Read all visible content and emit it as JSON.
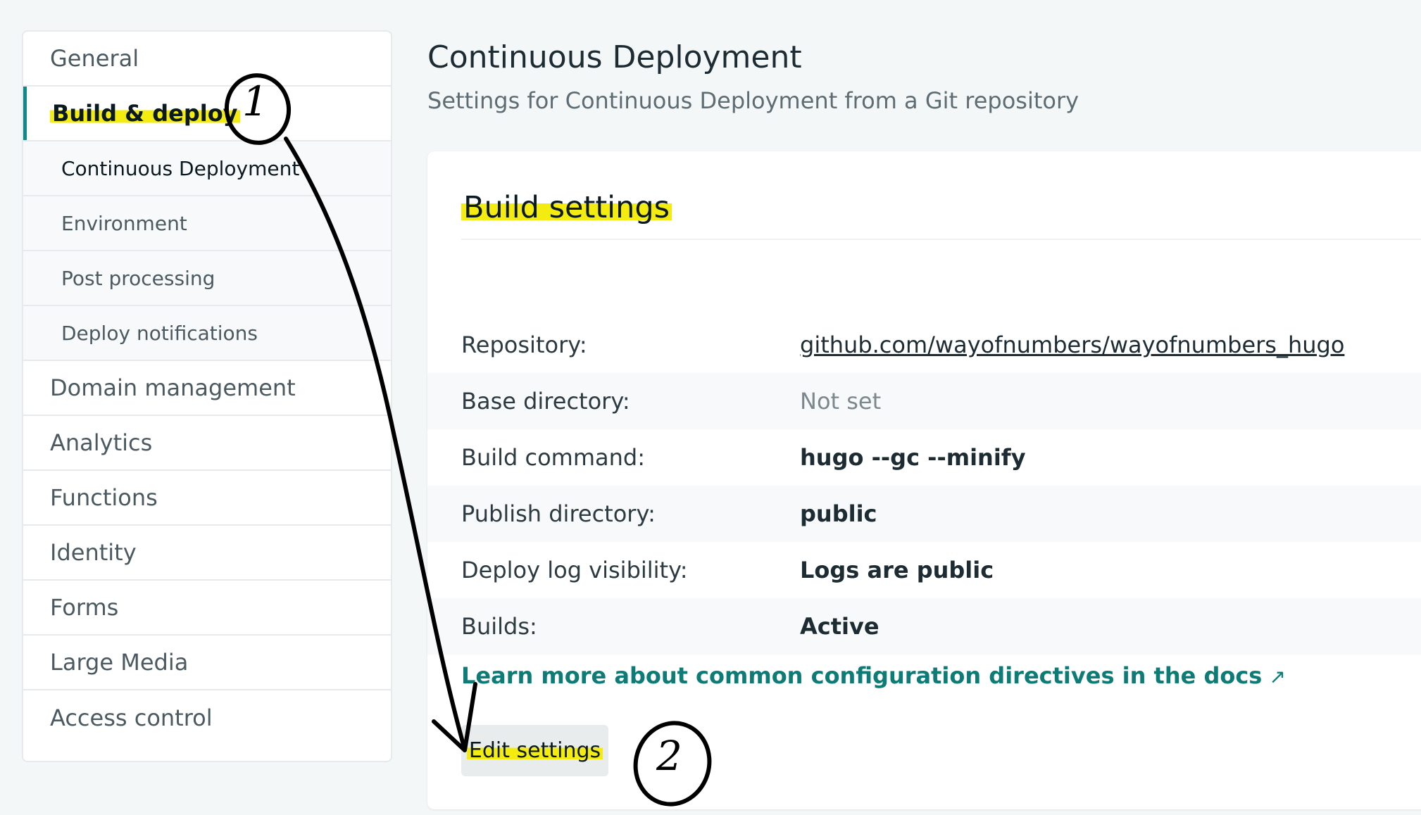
{
  "sidebar": {
    "items": [
      {
        "label": "General"
      },
      {
        "label": "Build & deploy"
      },
      {
        "label": "Continuous Deployment"
      },
      {
        "label": "Environment"
      },
      {
        "label": "Post processing"
      },
      {
        "label": "Deploy notifications"
      },
      {
        "label": "Domain management"
      },
      {
        "label": "Analytics"
      },
      {
        "label": "Functions"
      },
      {
        "label": "Identity"
      },
      {
        "label": "Forms"
      },
      {
        "label": "Large Media"
      },
      {
        "label": "Access control"
      }
    ]
  },
  "header": {
    "title": "Continuous Deployment",
    "subtitle": "Settings for Continuous Deployment from a Git repository"
  },
  "build_settings": {
    "title": "Build settings",
    "rows": [
      {
        "label": "Repository:",
        "value": "github.com/wayofnumbers/wayofnumbers_hugo"
      },
      {
        "label": "Base directory:",
        "value": "Not set"
      },
      {
        "label": "Build command:",
        "value": "hugo --gc --minify"
      },
      {
        "label": "Publish directory:",
        "value": "public"
      },
      {
        "label": "Deploy log visibility:",
        "value": "Logs are public"
      },
      {
        "label": "Builds:",
        "value": "Active"
      }
    ],
    "docs_link": "Learn more about common configuration directives in the docs",
    "docs_arrow": "↗",
    "edit_button": "Edit settings"
  },
  "annotations": {
    "step1": "1",
    "step2": "2"
  },
  "colors": {
    "accent": "#0e8a8a",
    "link": "#0d7c77",
    "highlight": "#f4ec10"
  }
}
